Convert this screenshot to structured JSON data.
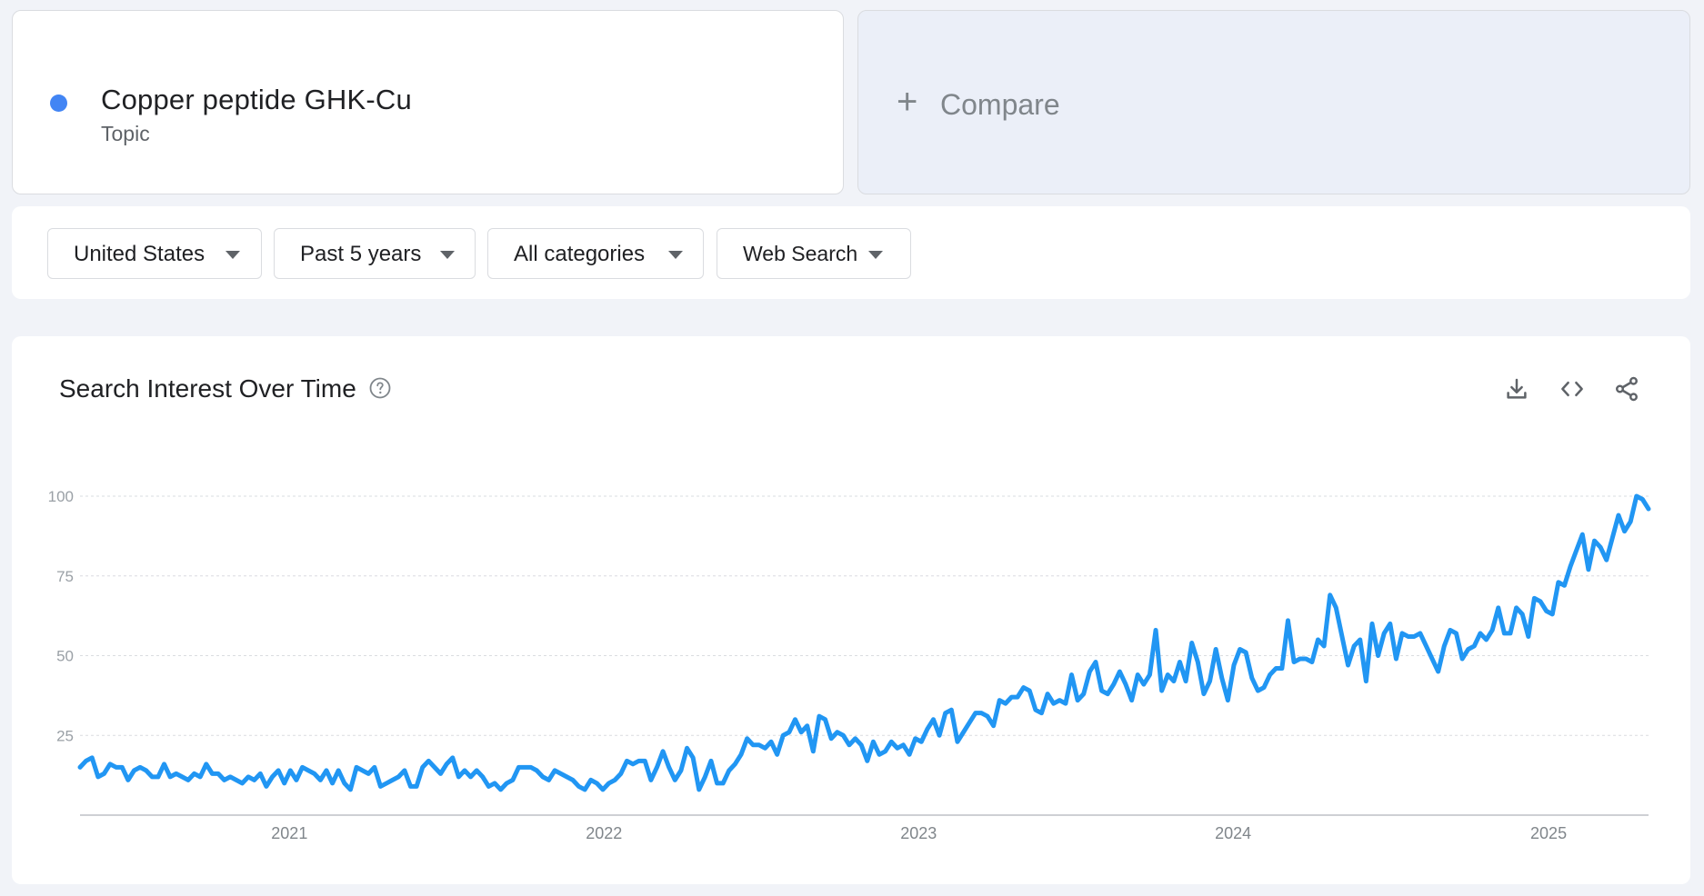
{
  "term": {
    "name": "Copper peptide GHK-Cu",
    "type": "Topic",
    "color": "#4285f4"
  },
  "compare": {
    "label": "Compare"
  },
  "filters": {
    "region": "United States",
    "timeframe": "Past 5 years",
    "category": "All categories",
    "property": "Web Search"
  },
  "chart": {
    "title": "Search Interest Over Time",
    "actions": [
      "download-icon",
      "embed-icon",
      "share-icon"
    ]
  },
  "chart_data": {
    "type": "line",
    "title": "Search Interest Over Time",
    "xlabel": "",
    "ylabel": "",
    "ylim": [
      0,
      100
    ],
    "yticks": [
      25,
      50,
      75,
      100
    ],
    "x_tick_labels": [
      "2021",
      "2022",
      "2023",
      "2024",
      "2025"
    ],
    "x_range": [
      "2020-05-03",
      "2025-04-27"
    ],
    "grid": true,
    "legend": "none",
    "line_color": "#2196f3",
    "series": [
      {
        "values": [
          15,
          17,
          18,
          12,
          13,
          16,
          15,
          15,
          11,
          14,
          15,
          14,
          12,
          12,
          16,
          12,
          13,
          12,
          11,
          13,
          12,
          16,
          13,
          13,
          11,
          12,
          11,
          10,
          12,
          11,
          13,
          9,
          12,
          14,
          10,
          14,
          11,
          15,
          14,
          13,
          11,
          14,
          10,
          14,
          10,
          8,
          15,
          14,
          13,
          15,
          9,
          10,
          11,
          12,
          14,
          9,
          9,
          15,
          17,
          15,
          13,
          16,
          18,
          12,
          14,
          12,
          14,
          12,
          9,
          10,
          8,
          10,
          11,
          15,
          15,
          15,
          14,
          12,
          11,
          14,
          13,
          12,
          11,
          9,
          8,
          11,
          10,
          8,
          10,
          11,
          13,
          17,
          16,
          17,
          17,
          11,
          15,
          20,
          15,
          11,
          14,
          21,
          18,
          8,
          12,
          17,
          10,
          10,
          14,
          16,
          19,
          24,
          22,
          22,
          21,
          23,
          19,
          25,
          26,
          30,
          26,
          28,
          20,
          31,
          30,
          24,
          26,
          25,
          22,
          24,
          22,
          17,
          23,
          19,
          20,
          23,
          21,
          22,
          19,
          24,
          23,
          27,
          30,
          25,
          32,
          33,
          23,
          26,
          29,
          32,
          32,
          31,
          28,
          36,
          35,
          37,
          37,
          40,
          39,
          33,
          32,
          38,
          35,
          36,
          35,
          44,
          36,
          38,
          45,
          48,
          39,
          38,
          41,
          45,
          41,
          36,
          44,
          41,
          44,
          58,
          39,
          44,
          42,
          48,
          42,
          54,
          48,
          38,
          42,
          52,
          43,
          36,
          47,
          52,
          51,
          43,
          39,
          40,
          44,
          46,
          46,
          61,
          48,
          49,
          49,
          48,
          55,
          53,
          69,
          65,
          56,
          47,
          53,
          55,
          42,
          60,
          50,
          57,
          60,
          49,
          57,
          56,
          56,
          57,
          53,
          49,
          45,
          53,
          58,
          57,
          49,
          52,
          53,
          57,
          55,
          58,
          65,
          57,
          57,
          65,
          63,
          56,
          68,
          67,
          64,
          63,
          73,
          72,
          78,
          83,
          88,
          77,
          86,
          84,
          80,
          87,
          94,
          89,
          92,
          100,
          99,
          96
        ]
      }
    ]
  }
}
